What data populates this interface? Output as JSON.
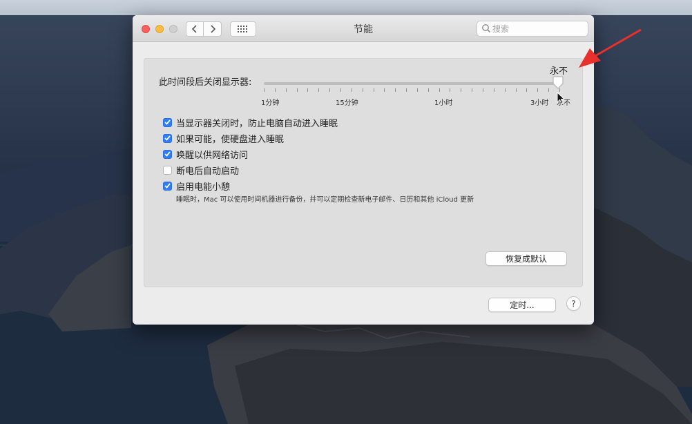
{
  "window": {
    "title": "节能",
    "search_placeholder": "搜索"
  },
  "display_sleep": {
    "label": "此时间段后关闭显示器:",
    "value": "永不",
    "ticks": [
      "1分钟",
      "15分钟",
      "1小时",
      "3小时",
      "永不"
    ],
    "setting_fraction": 1.0
  },
  "options": [
    {
      "label": "当显示器关闭时，防止电脑自动进入睡眠",
      "checked": true
    },
    {
      "label": "如果可能，使硬盘进入睡眠",
      "checked": true
    },
    {
      "label": "唤醒以供网络访问",
      "checked": true
    },
    {
      "label": "断电后自动启动",
      "checked": false
    },
    {
      "label": "启用电能小憩",
      "checked": true
    }
  ],
  "power_nap_note": "睡眠时，Mac 可以使用时间机器进行备份，并可以定期检查新电子邮件、日历和其他 iCloud 更新",
  "buttons": {
    "restore_defaults": "恢复成默认",
    "schedule": "定时...",
    "help": "?"
  },
  "colors": {
    "accent": "#2f7ef6",
    "annotation_arrow": "#e8302c"
  },
  "icons": {
    "back": "chevron-left-icon",
    "forward": "chevron-right-icon",
    "show_all": "grid-icon",
    "search": "magnifier-icon"
  }
}
